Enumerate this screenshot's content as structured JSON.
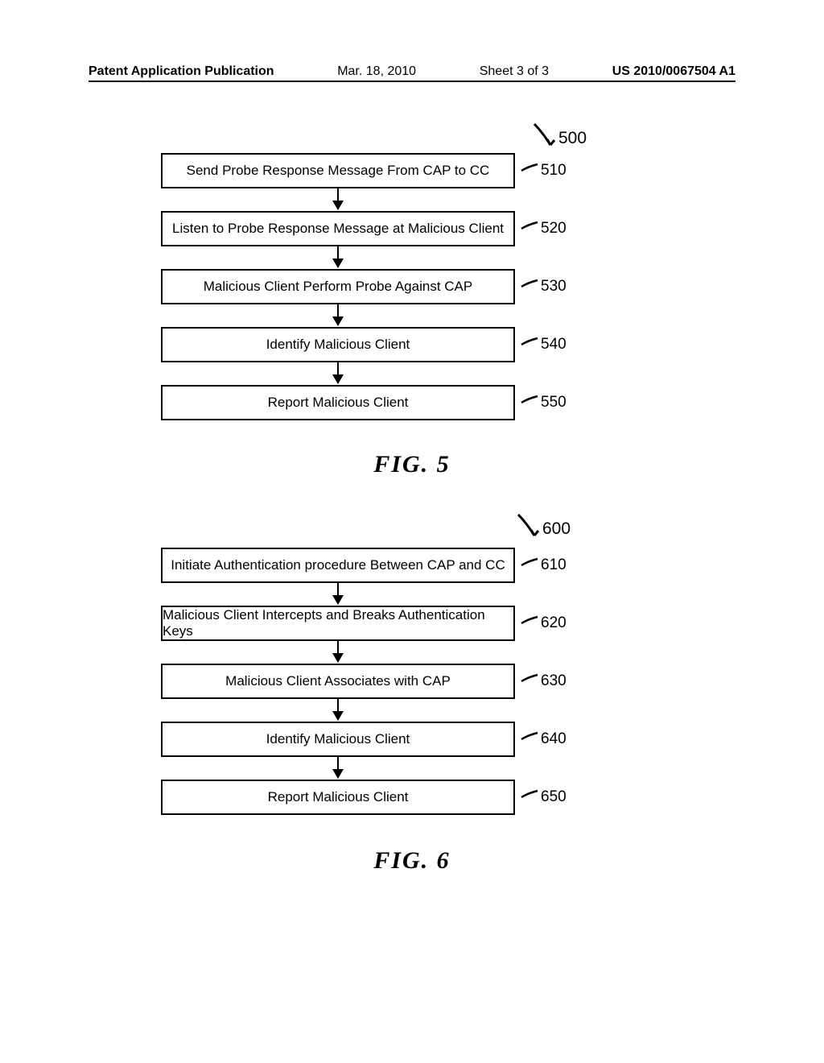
{
  "header": {
    "publication": "Patent Application Publication",
    "date": "Mar. 18, 2010",
    "sheet": "Sheet 3 of 3",
    "docnum": "US 2010/0067504 A1"
  },
  "fig5": {
    "ref": "500",
    "caption": "FIG.  5",
    "steps": [
      {
        "text": "Send Probe Response Message From CAP to CC",
        "ref": "510"
      },
      {
        "text": "Listen to Probe Response Message at Malicious Client",
        "ref": "520"
      },
      {
        "text": "Malicious Client Perform Probe Against CAP",
        "ref": "530"
      },
      {
        "text": "Identify Malicious Client",
        "ref": "540"
      },
      {
        "text": "Report Malicious Client",
        "ref": "550"
      }
    ]
  },
  "fig6": {
    "ref": "600",
    "caption": "FIG.  6",
    "steps": [
      {
        "text": "Initiate Authentication procedure Between CAP and CC",
        "ref": "610"
      },
      {
        "text": "Malicious Client Intercepts and Breaks Authentication Keys",
        "ref": "620"
      },
      {
        "text": "Malicious Client Associates with CAP",
        "ref": "630"
      },
      {
        "text": "Identify Malicious Client",
        "ref": "640"
      },
      {
        "text": "Report Malicious Client",
        "ref": "650"
      }
    ]
  }
}
